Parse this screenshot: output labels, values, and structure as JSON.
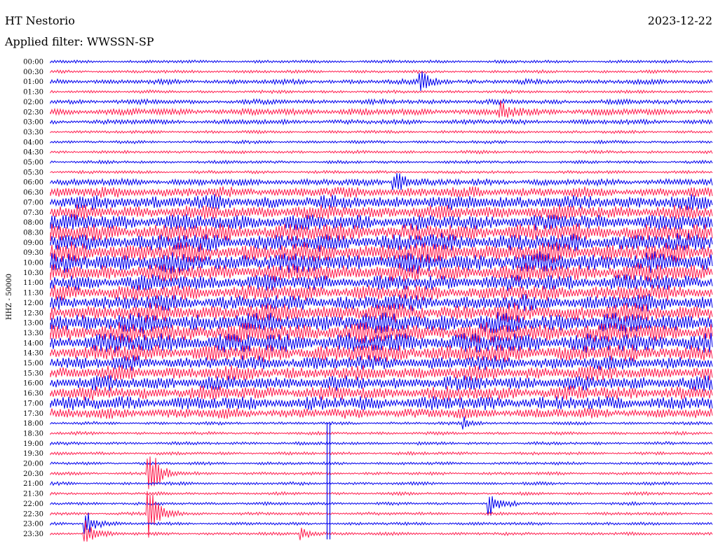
{
  "header": {
    "station": "HT Nestorio",
    "date": "2023-12-22",
    "filter_text": "Applied filter: WWSSN-SP"
  },
  "chart_data": {
    "type": "line",
    "title": "HT Nestorio",
    "subtitle": "Applied filter: WWSSN-SP",
    "date": "2023-12-22",
    "ylabel": "HHZ - 50000",
    "time_labels": [
      "00:00",
      "00:30",
      "01:00",
      "01:30",
      "02:00",
      "02:30",
      "03:00",
      "03:30",
      "04:00",
      "04:30",
      "05:00",
      "05:30",
      "06:00",
      "06:30",
      "07:00",
      "07:30",
      "08:00",
      "08:30",
      "09:00",
      "09:30",
      "10:00",
      "10:30",
      "11:00",
      "11:30",
      "12:00",
      "12:30",
      "13:00",
      "13:30",
      "14:00",
      "14:30",
      "15:00",
      "15:30",
      "16:00",
      "16:30",
      "17:00",
      "17:30",
      "18:00",
      "18:30",
      "19:00",
      "19:30",
      "20:00",
      "20:30",
      "21:00",
      "21:30",
      "22:00",
      "22:30",
      "23:00",
      "23:30"
    ],
    "trace_colors": [
      "#0000ee",
      "#ff1f50"
    ],
    "relative_activity": [
      1,
      1,
      2,
      1,
      2,
      3,
      2,
      1,
      1,
      1,
      1,
      1,
      3,
      5,
      7,
      7,
      8,
      9,
      9,
      10,
      10,
      9,
      8,
      8,
      8,
      9,
      10,
      10,
      10,
      9,
      7,
      7,
      7,
      7,
      7,
      5,
      1,
      1,
      1,
      1,
      1,
      1,
      1,
      1,
      1,
      1,
      1,
      1
    ],
    "events": [
      {
        "row": 2,
        "x_fraction": 0.56,
        "amplitude": 2.5
      },
      {
        "row": 5,
        "x_fraction": 0.68,
        "amplitude": 2.0
      },
      {
        "row": 12,
        "x_fraction": 0.52,
        "amplitude": 3.0
      },
      {
        "row": 36,
        "x_fraction": 0.625,
        "amplitude": 1.2
      },
      {
        "row": 41,
        "x_fraction": 0.15,
        "amplitude": 6.0
      },
      {
        "row": 44,
        "x_fraction": 0.665,
        "amplitude": 2.5
      },
      {
        "row": 45,
        "x_fraction": 0.15,
        "amplitude": 6.0
      },
      {
        "row": 46,
        "x_fraction": 0.053,
        "amplitude": 3.0
      },
      {
        "row": 47,
        "x_fraction": 0.053,
        "amplitude": 2.8
      },
      {
        "row": 47,
        "x_fraction": 0.38,
        "amplitude": 1.5
      }
    ],
    "teleseism_x_fraction": 0.42,
    "grid": false,
    "legend": "none"
  }
}
